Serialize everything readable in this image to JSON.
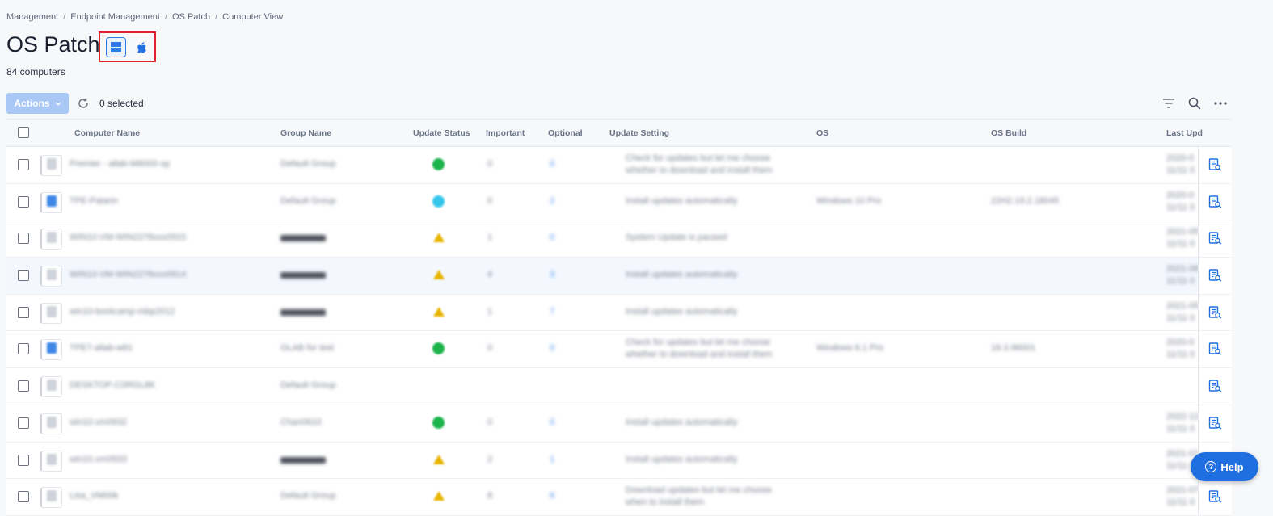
{
  "breadcrumb": [
    "Management",
    "Endpoint Management",
    "OS Patch",
    "Computer View"
  ],
  "breadcrumb_separator": "/",
  "page_title": "OS Patch",
  "os_switch": {
    "windows_icon": "windows-icon",
    "mac_icon": "apple-icon",
    "selected": "windows"
  },
  "computer_count": "84 computers",
  "toolbar": {
    "actions_label": "Actions",
    "selected_label": "0 selected"
  },
  "columns": [
    "Computer Name",
    "Group Name",
    "Update Status",
    "Important",
    "Optional",
    "Update Setting",
    "OS",
    "OS Build",
    "Last Upd"
  ],
  "rows": [
    {
      "name": "Premier - allab-M8000-xp",
      "group": "Default Group",
      "status": "green",
      "important": "0",
      "optional": "0",
      "setting": [
        "Check for updates but let me choose",
        "whether to download and install them"
      ],
      "os": "",
      "build": "",
      "last": [
        "2020-0",
        "11/11 0"
      ]
    },
    {
      "name": "TPE-Patarin",
      "group": "Default Group",
      "status": "cyan",
      "important": "0",
      "optional": "2",
      "setting": [
        "Install updates automatically"
      ],
      "os": "Windows 10 Pro",
      "build": "22H2.19.2.18045",
      "last": [
        "2020-0",
        "11/11 0"
      ]
    },
    {
      "name": "WIN10-VM-WIN2278xxx0915",
      "group": "masked",
      "status": "warn",
      "important": "1",
      "optional": "0",
      "setting": [
        "System Update is paused"
      ],
      "os": "",
      "build": "",
      "last": [
        "2021-05",
        "11/11 0"
      ]
    },
    {
      "name": "WIN10-VM-WIN2278xxx0914",
      "group": "masked",
      "status": "warn",
      "important": "4",
      "optional": "3",
      "setting": [
        "Install updates automatically"
      ],
      "os": "",
      "build": "",
      "last": [
        "2021-08",
        "11/11 0"
      ]
    },
    {
      "name": "win10-bootcamp-mbp2012",
      "group": "masked",
      "status": "warn",
      "important": "1",
      "optional": "7",
      "setting": [
        "Install updates automatically"
      ],
      "os": "",
      "build": "",
      "last": [
        "2021-05",
        "11/11 0"
      ]
    },
    {
      "name": "TPE7-allab-w81",
      "group": "GLAB for test",
      "status": "green",
      "important": "0",
      "optional": "0",
      "setting": [
        "Check for updates but let me choose",
        "whether to download and install them"
      ],
      "os": "Windows 8.1 Pro",
      "build": "18.3.96001",
      "last": [
        "2020-0",
        "11/11 0"
      ]
    },
    {
      "name": "DESKTOP-C0RGL8K",
      "group": "Default Group",
      "status": "",
      "important": "",
      "optional": "",
      "setting": [
        ""
      ],
      "os": "",
      "build": "",
      "last": [
        "",
        ""
      ]
    },
    {
      "name": "win10.vm0932",
      "group": "Chan0610",
      "status": "green",
      "important": "0",
      "optional": "0",
      "setting": [
        "Install updates automatically"
      ],
      "os": "",
      "build": "",
      "last": [
        "2022-12",
        "11/11 0"
      ]
    },
    {
      "name": "win10.vm0933",
      "group": "masked",
      "status": "warn",
      "important": "2",
      "optional": "1",
      "setting": [
        "Install updates automatically"
      ],
      "os": "",
      "build": "",
      "last": [
        "2021-07",
        "11/11 0"
      ]
    },
    {
      "name": "Lisa_VM00k",
      "group": "Default Group",
      "status": "warn",
      "important": "8",
      "optional": "6",
      "setting": [
        "Download updates but let me choose",
        "when to install them"
      ],
      "os": "",
      "build": "",
      "last": [
        "2021-07",
        "11/11 0"
      ]
    }
  ],
  "help_label": "Help",
  "colors": {
    "accent": "#1f6fe0",
    "highlight_box": "#e0202a",
    "status_ok": "#1bb34a",
    "status_warn": "#e8b400",
    "status_info": "#35c6ec"
  }
}
